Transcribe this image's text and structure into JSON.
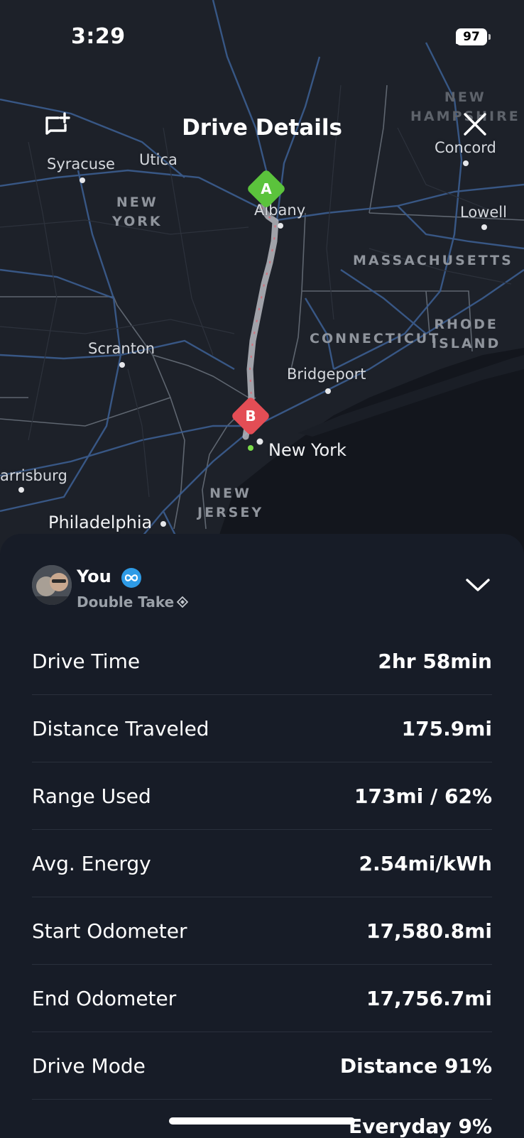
{
  "status_bar": {
    "time": "3:29",
    "battery": "97"
  },
  "header": {
    "title": "Drive Details",
    "left_icon": "chat-add-icon",
    "right_icon": "close-icon"
  },
  "map": {
    "states": {
      "new_york": [
        "NEW",
        "YORK"
      ],
      "new_hampshire": [
        "NEW",
        "HAMPSHIRE"
      ],
      "massachusetts": "MASSACHUSETTS",
      "connecticut": "CONNECTICUT",
      "rhode_island": [
        "RHODE",
        "ISLAND"
      ],
      "new_jersey": [
        "NEW",
        "JERSEY"
      ]
    },
    "cities": {
      "syracuse": "Syracuse",
      "utica": "Utica",
      "albany": "Albany",
      "concord": "Concord",
      "lowell": "Lowell",
      "scranton": "Scranton",
      "bridgeport": "Bridgeport",
      "new_york": "New York",
      "harrisburg": "arrisburg",
      "philadelphia": "Philadelphia"
    },
    "start_marker": "A",
    "end_marker": "B",
    "colors": {
      "start": "#5bc33c",
      "end": "#e34d55",
      "route": "#b7b9bf"
    }
  },
  "user": {
    "name": "You",
    "vehicle": "Double Take",
    "badge_icon": "infinity-icon",
    "badge_color": "#2e9be6"
  },
  "details": [
    {
      "label": "Drive Time",
      "value": "2hr 58min"
    },
    {
      "label": "Distance Traveled",
      "value": "175.9mi"
    },
    {
      "label": "Range Used",
      "value": "173mi / 62%"
    },
    {
      "label": "Avg. Energy",
      "value": "2.54mi/kWh"
    },
    {
      "label": "Start Odometer",
      "value": "17,580.8mi"
    },
    {
      "label": "End Odometer",
      "value": "17,756.7mi"
    },
    {
      "label": "Drive Mode",
      "value": "Distance 91%"
    }
  ],
  "drive_mode_extra": "Everyday 9%"
}
